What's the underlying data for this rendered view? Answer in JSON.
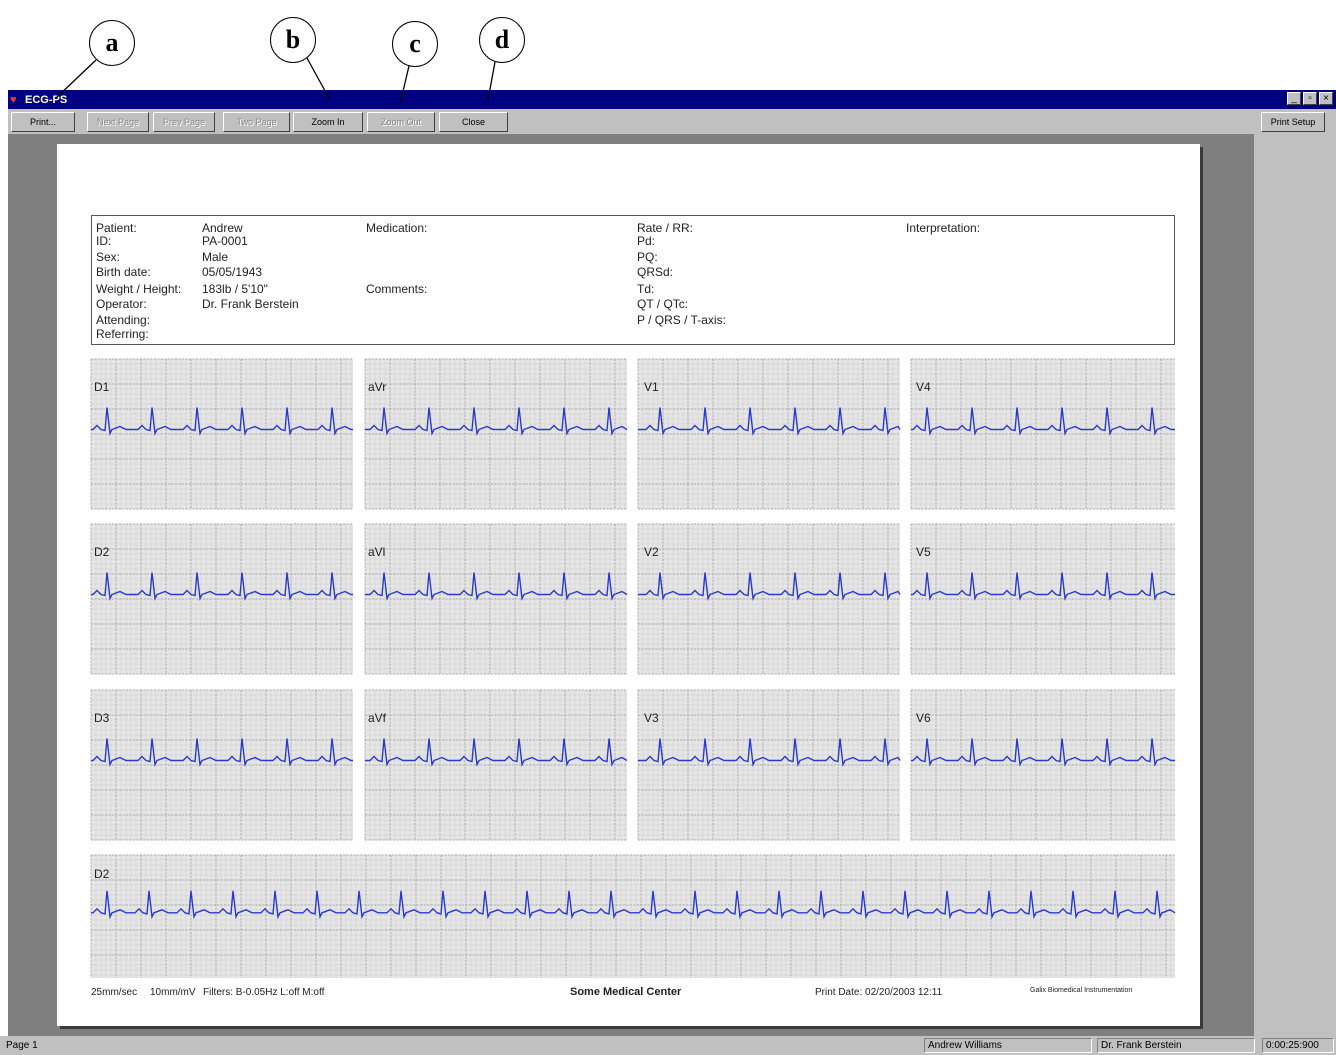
{
  "callouts": [
    "a",
    "b",
    "c",
    "d"
  ],
  "window": {
    "title": "ECG-PS",
    "controls": [
      "_",
      "▫",
      "×"
    ]
  },
  "toolbar": {
    "print": "Print...",
    "next_page": "Next Page",
    "prev_page": "Prev Page",
    "two_page": "Two Page",
    "zoom_in": "Zoom In",
    "zoom_out": "Zoom Out",
    "close": "Close",
    "print_setup": "Print Setup"
  },
  "patient": {
    "labels": [
      "Patient:",
      "ID:",
      "Sex:",
      "Birth date:",
      "Weight / Height:",
      "Operator:",
      "Attending:",
      "Referring:"
    ],
    "values": [
      "Andrew",
      "PA-0001",
      "Male",
      "05/05/1943",
      "183lb / 5'10\"",
      "Dr. Frank Berstein",
      "",
      ""
    ],
    "medication": "Medication:",
    "comments": "Comments:",
    "measure_labels": [
      "Rate / RR:",
      "Pd:",
      "PQ:",
      "QRSd:",
      "Td:",
      "QT / QTc:",
      "P / QRS / T-axis:"
    ],
    "interpretation": "Interpretation:"
  },
  "leads": {
    "row1": [
      "D1",
      "aVr",
      "V1",
      "V4"
    ],
    "row2": [
      "D2",
      "aVl",
      "V2",
      "V5"
    ],
    "row3": [
      "D3",
      "aVf",
      "V3",
      "V6"
    ],
    "rhythm": "D2"
  },
  "ecg_style": {
    "grid_bg": "#e6e6e6",
    "grid_line": "#b8b8b8",
    "trace": "#2a3acd"
  },
  "footer": {
    "speed": "25mm/sec",
    "gain": "10mm/mV",
    "filters": "Filters: B-0.05Hz L:off M:off",
    "center": "Some Medical Center",
    "print_date": "Print Date: 02/20/2003 12:11",
    "company": "Galix Biomedical Instrumentation"
  },
  "status": {
    "page": "Page 1",
    "patient": "Andrew Williams",
    "doctor": "Dr. Frank Berstein",
    "time": "0:00:25:900"
  }
}
